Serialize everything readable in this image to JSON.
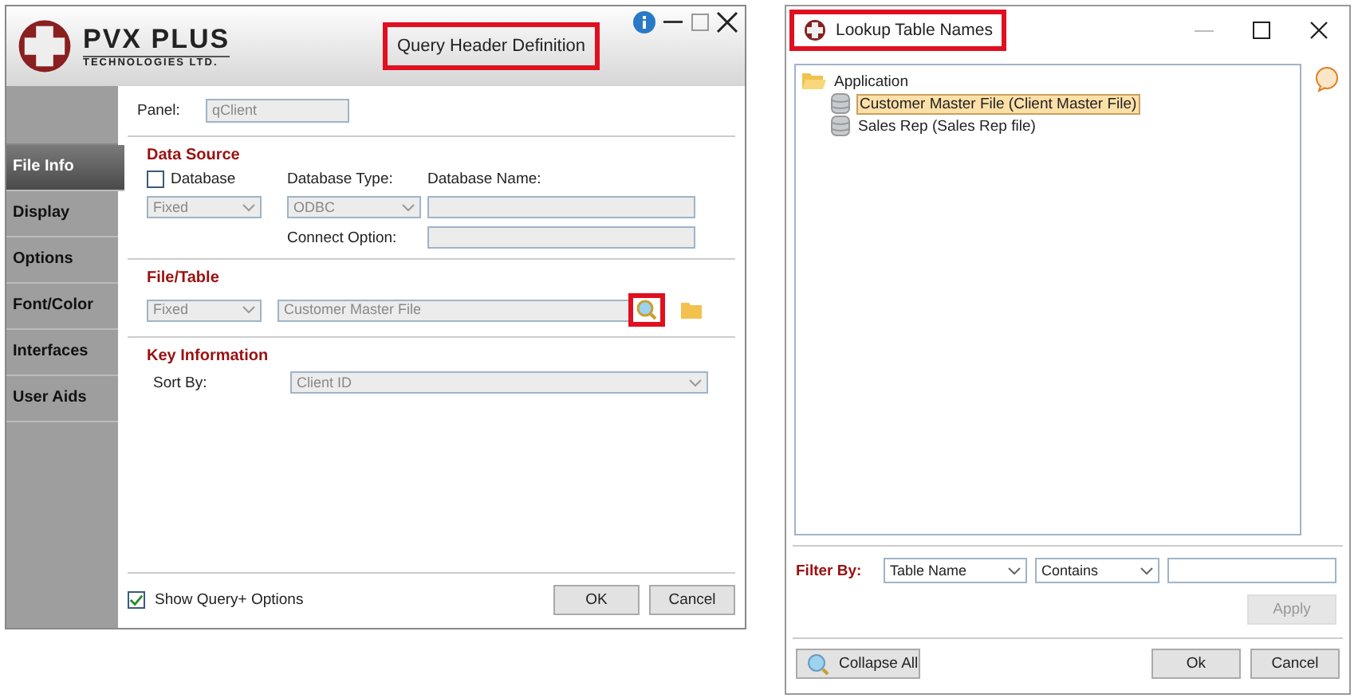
{
  "query_window": {
    "title": "Query Header Definition",
    "logo": {
      "name": "PVX PLUS",
      "tagline": "TECHNOLOGIES LTD."
    },
    "nav": [
      {
        "label": "File Info",
        "selected": true
      },
      {
        "label": "Display",
        "selected": false
      },
      {
        "label": "Options",
        "selected": false
      },
      {
        "label": "Font/Color",
        "selected": false
      },
      {
        "label": "Interfaces",
        "selected": false
      },
      {
        "label": "User Aids",
        "selected": false
      }
    ],
    "panel": {
      "label": "Panel:",
      "value": "qClient"
    },
    "data_source": {
      "heading": "Data Source",
      "database": {
        "label": "Database",
        "checked": false
      },
      "type_value": "Fixed",
      "db_type_label": "Database Type:",
      "db_type_value": "ODBC",
      "db_name_label": "Database Name:",
      "connect_label": "Connect Option:"
    },
    "file_table": {
      "heading": "File/Table",
      "type_value": "Fixed",
      "value": "Customer Master File"
    },
    "key_info": {
      "heading": "Key Information",
      "sort_label": "Sort By:",
      "sort_value": "Client ID"
    },
    "show_options": {
      "label": "Show Query+ Options",
      "checked": true
    },
    "buttons": [
      "OK",
      "Cancel"
    ]
  },
  "lookup_window": {
    "title": "Lookup Table Names",
    "tree": [
      {
        "label": "Application",
        "expanded": true,
        "children": [
          {
            "label": "Customer Master File  (Client Master File)",
            "selected": true
          },
          {
            "label": "Sales Rep  (Sales Rep file)",
            "selected": false
          }
        ]
      }
    ],
    "filter": {
      "label": "Filter By:",
      "field": "Table Name",
      "operator": "Contains"
    },
    "apply": {
      "label": "Apply",
      "disabled": true
    },
    "collapse": "Collapse All",
    "buttons": [
      "Ok",
      "Cancel"
    ]
  }
}
